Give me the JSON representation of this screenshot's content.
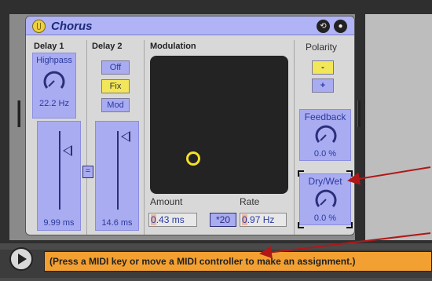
{
  "device": {
    "title": "Chorus",
    "icons": [
      "power-icon",
      "hot-swap-icon",
      "save-preset-icon"
    ],
    "hot_swap_glyph": "⟲",
    "save_glyph": "●"
  },
  "delay1": {
    "label": "Delay 1",
    "highpass_label": "Highpass",
    "highpass_value": "22.2 Hz",
    "time_value": "9.99 ms"
  },
  "delay2": {
    "label": "Delay 2",
    "buttons": [
      "Off",
      "Fix",
      "Mod"
    ],
    "time_value": "14.6 ms"
  },
  "link_button": "=",
  "modulation": {
    "label": "Modulation",
    "amount_label": "Amount",
    "amount_value_highlight": "0",
    "amount_value_rest": ".43 ms",
    "rate_label": "Rate",
    "rate_multiplier": "*20",
    "rate_value_highlight": "0",
    "rate_value_rest": ".97 Hz"
  },
  "polarity": {
    "label": "Polarity",
    "minus": "-",
    "plus": "+"
  },
  "feedback": {
    "label": "Feedback",
    "value": "0.0 %"
  },
  "drywet": {
    "label": "Dry/Wet",
    "value": "0.0 %"
  },
  "status_bar": {
    "message": "(Press a MIDI key or move a MIDI controller to make an assignment.)"
  },
  "colors": {
    "accent_blue": "#a9acf0",
    "active_yellow": "#f2e65a",
    "status_orange": "#f3a032",
    "arrow_red": "#b01818"
  }
}
